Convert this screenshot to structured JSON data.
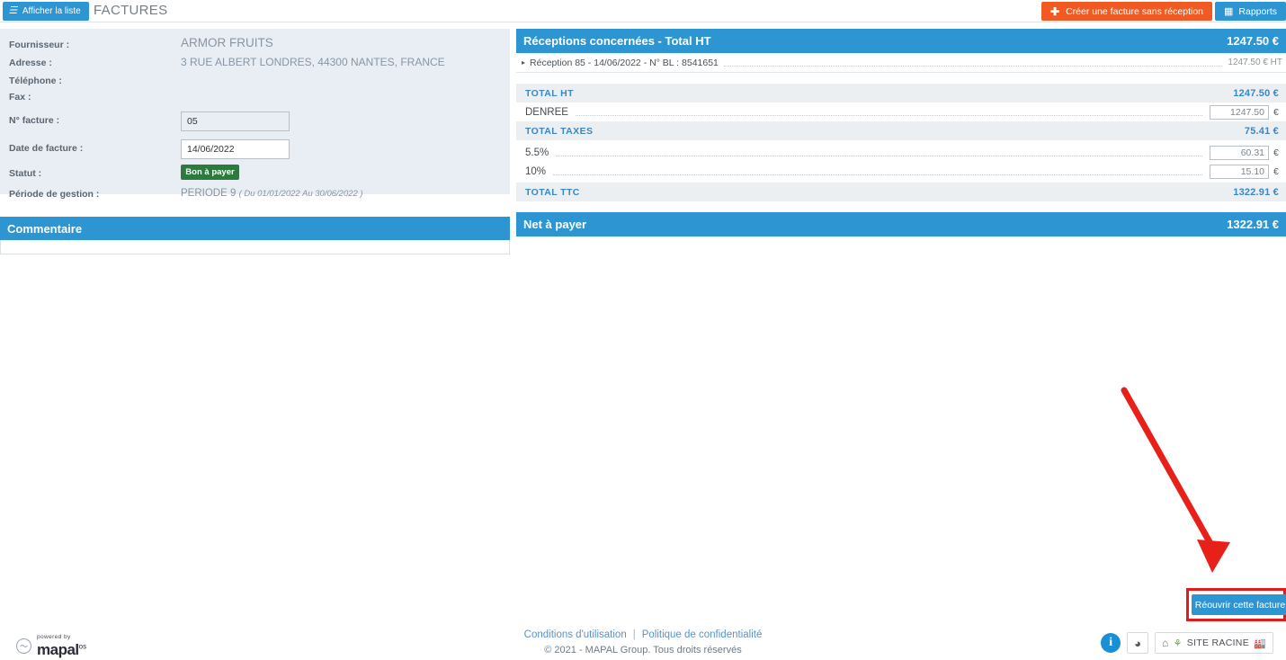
{
  "topbar": {
    "list_button": "Afficher la liste",
    "list_icon": "list-lines-icon",
    "page_title": "FACTURES",
    "create_button": "Créer une facture sans réception",
    "create_icon": "plus-icon",
    "reports_button": "Rapports",
    "reports_icon": "chart-icon"
  },
  "invoice": {
    "labels": {
      "supplier": "Fournisseur :",
      "address": "Adresse :",
      "phone": "Téléphone :",
      "fax": "Fax :",
      "invoice_number": "N° facture :",
      "invoice_date": "Date de facture :",
      "status": "Statut :",
      "period": "Période de gestion :"
    },
    "supplier": "ARMOR FRUITS",
    "address": "3 RUE ALBERT LONDRES, 44300 NANTES, FRANCE",
    "phone": "",
    "fax": "",
    "invoice_number": "05",
    "invoice_date": "14/06/2022",
    "status_badge": "Bon à payer",
    "period_name": "PERIODE 9",
    "period_range": "( Du 01/01/2022 Au 30/06/2022 )"
  },
  "comment": {
    "title": "Commentaire",
    "body": ""
  },
  "receptions": {
    "header_label": "Réceptions concernées - Total HT",
    "header_amount": "1247.50 €",
    "rows": [
      {
        "caret": "▸",
        "label": "Réception 85  -  14/06/2022  -  N° BL : 8541651",
        "amount": "1247.50 € HT"
      }
    ]
  },
  "totals": {
    "total_ht_label": "TOTAL HT",
    "total_ht_value": "1247.50 €",
    "lines_ht": [
      {
        "label": "DENREE",
        "amount": "1247.50",
        "currency": "€"
      }
    ],
    "total_taxes_label": "TOTAL TAXES",
    "total_taxes_value": "75.41 €",
    "lines_taxes": [
      {
        "label": "5.5%",
        "amount": "60.31",
        "currency": "€"
      },
      {
        "label": "10%",
        "amount": "15.10",
        "currency": "€"
      }
    ],
    "total_ttc_label": "TOTAL TTC",
    "total_ttc_value": "1322.91 €"
  },
  "net": {
    "label": "Net à payer",
    "value": "1322.91 €"
  },
  "actions": {
    "reopen_button": "Réouvrir cette facture",
    "highlight_color": "#e01b1b",
    "arrow_color": "#e8201a"
  },
  "footer": {
    "terms_link": "Conditions d'utilisation",
    "separator": "|",
    "privacy_link": "Politique de confidentialité",
    "copyright": "© 2021 - MAPAL Group. Tous droits réservés",
    "powered_by": "powered by",
    "brand": "mapal",
    "brand_suffix": "os",
    "info_icon": "info-icon",
    "feedback_icon": "feedback-icon",
    "home_icon": "home-icon",
    "site_icon": "plant-icon",
    "site_label": "SITE RACINE",
    "building_icon": "factory-icon"
  },
  "theme": {
    "blue": "#2e95d3",
    "orange": "#f15a22",
    "green": "#2d7a3e",
    "panel_bg": "#e9eef4",
    "row_head_bg": "#eceff1"
  }
}
